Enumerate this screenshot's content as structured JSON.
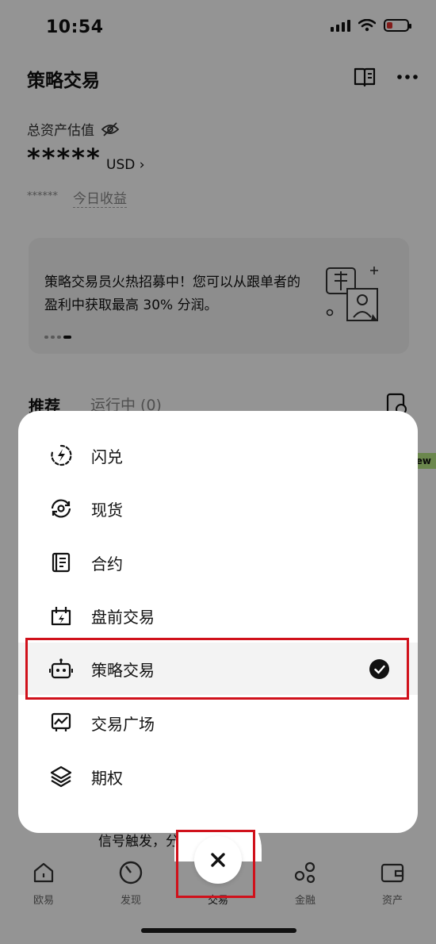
{
  "status_bar": {
    "time": "10:54"
  },
  "header": {
    "title": "策略交易"
  },
  "assets": {
    "label": "总资产估值",
    "masked_value": "*****",
    "currency": "USD",
    "pnl_masked": "******",
    "pnl_label": "今日收益"
  },
  "banner": {
    "text": "策略交易员火热招募中！您可以从跟单者的盈利中获取最高 30% 分润。"
  },
  "tabs": {
    "recommended": "推荐",
    "running": "运行中 (0)"
  },
  "new_badge": "New",
  "background_text": "信号触发，分批下单",
  "menu": {
    "items": [
      {
        "label": "闪兑",
        "icon": "flash-swap-icon"
      },
      {
        "label": "现货",
        "icon": "spot-icon"
      },
      {
        "label": "合约",
        "icon": "contract-icon"
      },
      {
        "label": "盘前交易",
        "icon": "pre-market-icon"
      },
      {
        "label": "策略交易",
        "icon": "bot-icon",
        "selected": true
      },
      {
        "label": "交易广场",
        "icon": "chart-icon"
      },
      {
        "label": "期权",
        "icon": "layers-icon"
      }
    ]
  },
  "bottom_nav": {
    "items": [
      {
        "label": "欧易",
        "icon": "home-icon"
      },
      {
        "label": "发现",
        "icon": "discover-icon"
      },
      {
        "label": "交易",
        "icon": "close-icon"
      },
      {
        "label": "金融",
        "icon": "finance-icon"
      },
      {
        "label": "资产",
        "icon": "wallet-icon"
      }
    ]
  },
  "colors": {
    "highlight": "#d0111b",
    "new_badge": "#b8e986",
    "overlay": "rgba(0,0,0,0.42)"
  }
}
